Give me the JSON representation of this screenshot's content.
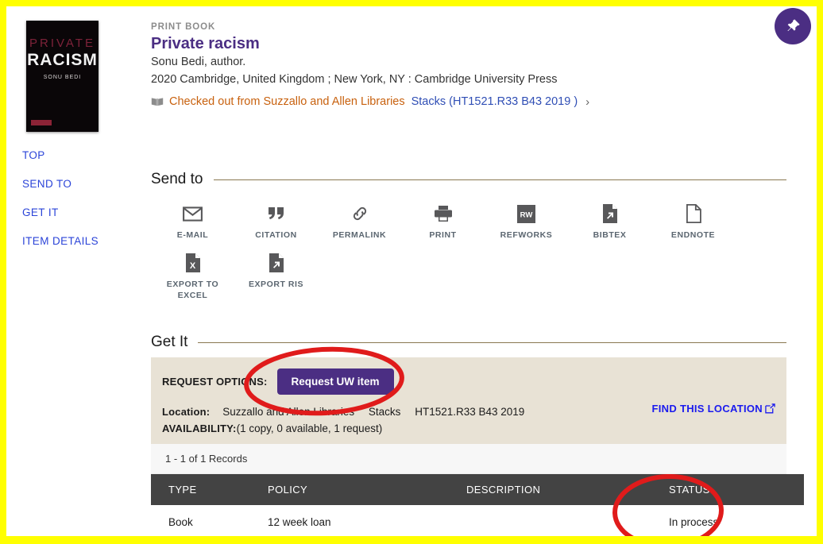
{
  "window": {
    "highlight_border_color": "#ffff00",
    "accent_color": "#4b2e83",
    "annotation_color": "#e01b1b"
  },
  "pin_button": {
    "icon": "pushpin-icon",
    "label": "Pin",
    "background_color": "#4b2e83"
  },
  "cover": {
    "title_line1": "PRIVATE",
    "title_line2": "RACISM",
    "author": "SONU BEDI",
    "background_color": "#0a0608",
    "title_line1_color": "#7d2239"
  },
  "record": {
    "type": "PRINT BOOK",
    "title": "Private racism",
    "author": "Sonu Bedi, author.",
    "publication": "2020 Cambridge, United Kingdom ; New York, NY : Cambridge University Press",
    "availability": {
      "icon": "open-book-icon",
      "status": "Checked out from Suzzallo and Allen Libraries",
      "location": "Stacks (HT1521.R33 B43 2019 )",
      "chevron": "›"
    }
  },
  "left_nav": {
    "items": [
      {
        "label": "TOP",
        "name": "top"
      },
      {
        "label": "SEND TO",
        "name": "send-to"
      },
      {
        "label": "GET IT",
        "name": "get-it"
      },
      {
        "label": "ITEM DETAILS",
        "name": "item-details"
      }
    ]
  },
  "send_to": {
    "heading": "Send to",
    "items": [
      {
        "label": "E-MAIL",
        "icon": "envelope-icon",
        "name": "email"
      },
      {
        "label": "CITATION",
        "icon": "quote-icon",
        "name": "citation"
      },
      {
        "label": "PERMALINK",
        "icon": "link-icon",
        "name": "permalink"
      },
      {
        "label": "PRINT",
        "icon": "printer-icon",
        "name": "print"
      },
      {
        "label": "REFWORKS",
        "icon": "refworks-icon",
        "name": "refworks"
      },
      {
        "label": "BIBTEX",
        "icon": "bibtex-file-icon",
        "name": "bibtex"
      },
      {
        "label": "ENDNOTE",
        "icon": "document-icon",
        "name": "endnote"
      },
      {
        "label": "EXPORT TO EXCEL",
        "icon": "excel-file-icon",
        "name": "export-excel"
      },
      {
        "label": "EXPORT RIS",
        "icon": "ris-file-icon",
        "name": "export-ris"
      }
    ]
  },
  "get_it": {
    "heading": "Get It",
    "request_options_label": "REQUEST OPTIONS:",
    "request_button_label": "Request UW item",
    "location_label": "Location:",
    "location_library": "Suzzallo and Allen Libraries",
    "location_collection": "Stacks",
    "location_callnumber": "HT1521.R33 B43 2019",
    "find_location_label": "FIND THIS LOCATION",
    "find_location_icon": "external-link-icon",
    "availability_label": "AVAILABILITY:",
    "availability_value": "(1 copy, 0 available, 1 request)",
    "records_count": "1 - 1 of 1 Records",
    "table": {
      "columns": [
        "TYPE",
        "POLICY",
        "DESCRIPTION",
        "STATUS"
      ],
      "rows": [
        {
          "type": "Book",
          "policy": "12 week loan",
          "description": "",
          "status": "In process"
        }
      ]
    }
  },
  "annotations": [
    {
      "name": "request-button-circle",
      "shape": "ellipse",
      "target": "Request UW item"
    },
    {
      "name": "status-circle",
      "shape": "ellipse",
      "target": "In process"
    }
  ]
}
